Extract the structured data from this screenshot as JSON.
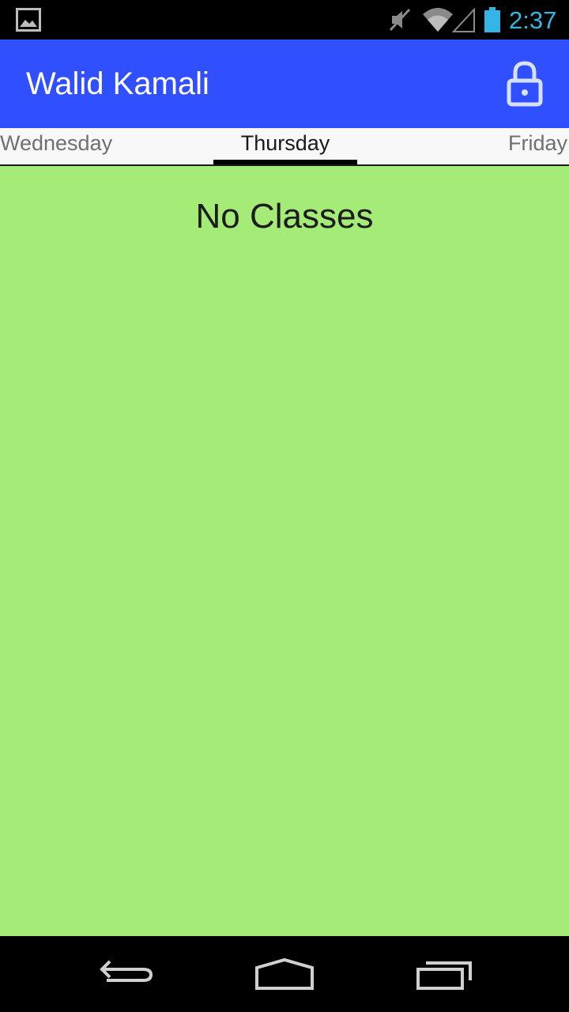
{
  "status_bar": {
    "time": "2:37",
    "icons": [
      "image-notification-icon",
      "muted-icon",
      "wifi-icon",
      "signal-icon",
      "battery-icon"
    ],
    "clock_color": "#33b5e5"
  },
  "action_bar": {
    "title": "Walid Kamali",
    "action_icon": "lock-icon",
    "background": "#3050ff"
  },
  "tabs": {
    "items": [
      {
        "label": "Wednesday",
        "selected": false
      },
      {
        "label": "Thursday",
        "selected": true
      },
      {
        "label": "Friday",
        "selected": false
      }
    ]
  },
  "content": {
    "message": "No Classes",
    "background": "#a5eb78"
  },
  "nav_bar": {
    "buttons": [
      "back-icon",
      "home-icon",
      "recents-icon"
    ]
  }
}
